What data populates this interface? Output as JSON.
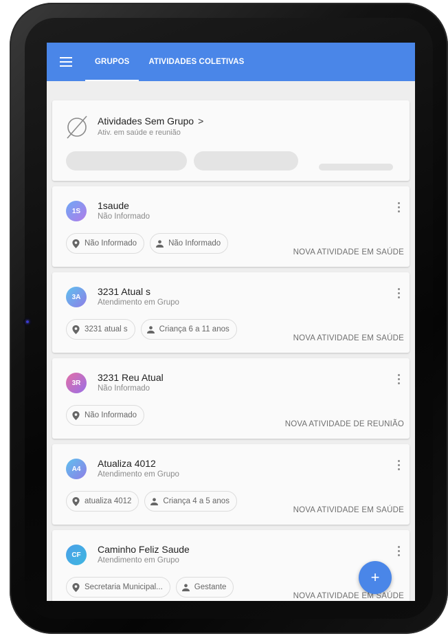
{
  "colors": {
    "primary": "#4a86e8",
    "device": "#0a0a0a"
  },
  "appbar": {
    "menu_icon": "hamburger-menu-icon",
    "tabs": [
      {
        "label": "GRUPOS",
        "active": true
      },
      {
        "label": "ATIVIDADES COLETIVAS",
        "active": false
      }
    ]
  },
  "no_group": {
    "title": "Atividades Sem Grupo",
    "chevron": ">",
    "subtitle": "Ativ. em saúde e reunião",
    "icon": "empty-set-icon"
  },
  "groups": [
    {
      "initials": "1S",
      "name": "1saude",
      "type": "Não Informado",
      "color_from": "#6ea8f5",
      "color_to": "#b07be8",
      "location": "Não Informado",
      "audience": "Não Informado",
      "action": "NOVA ATIVIDADE EM SAÚDE"
    },
    {
      "initials": "3A",
      "name": "3231 Atual s",
      "type": "Atendimento em Grupo",
      "color_from": "#5ec0ee",
      "color_to": "#8e7ee6",
      "location": "3231 atual s",
      "audience": "Criança 6 a 11 anos",
      "action": "NOVA ATIVIDADE EM SAÚDE"
    },
    {
      "initials": "3R",
      "name": "3231 Reu Atual",
      "type": "Não Informado",
      "color_from": "#e26fa6",
      "color_to": "#9a6fe6",
      "location": "Não Informado",
      "audience": "",
      "action": "NOVA ATIVIDADE DE REUNIÃO"
    },
    {
      "initials": "A4",
      "name": "Atualiza 4012",
      "type": "Atendimento em Grupo",
      "color_from": "#5ec0ee",
      "color_to": "#8e7ee6",
      "location": "atualiza 4012",
      "audience": "Criança 4 a 5 anos",
      "action": "NOVA ATIVIDADE EM SAÚDE"
    },
    {
      "initials": "CF",
      "name": "Caminho Feliz Saude",
      "type": "Atendimento em Grupo",
      "color_from": "#4aa0e8",
      "color_to": "#3fb6e0",
      "location": "Secretaria Municipal...",
      "audience": "Gestante",
      "action": "NOVA ATIVIDADE EM SAÚDE"
    }
  ],
  "fab": {
    "label": "+"
  }
}
